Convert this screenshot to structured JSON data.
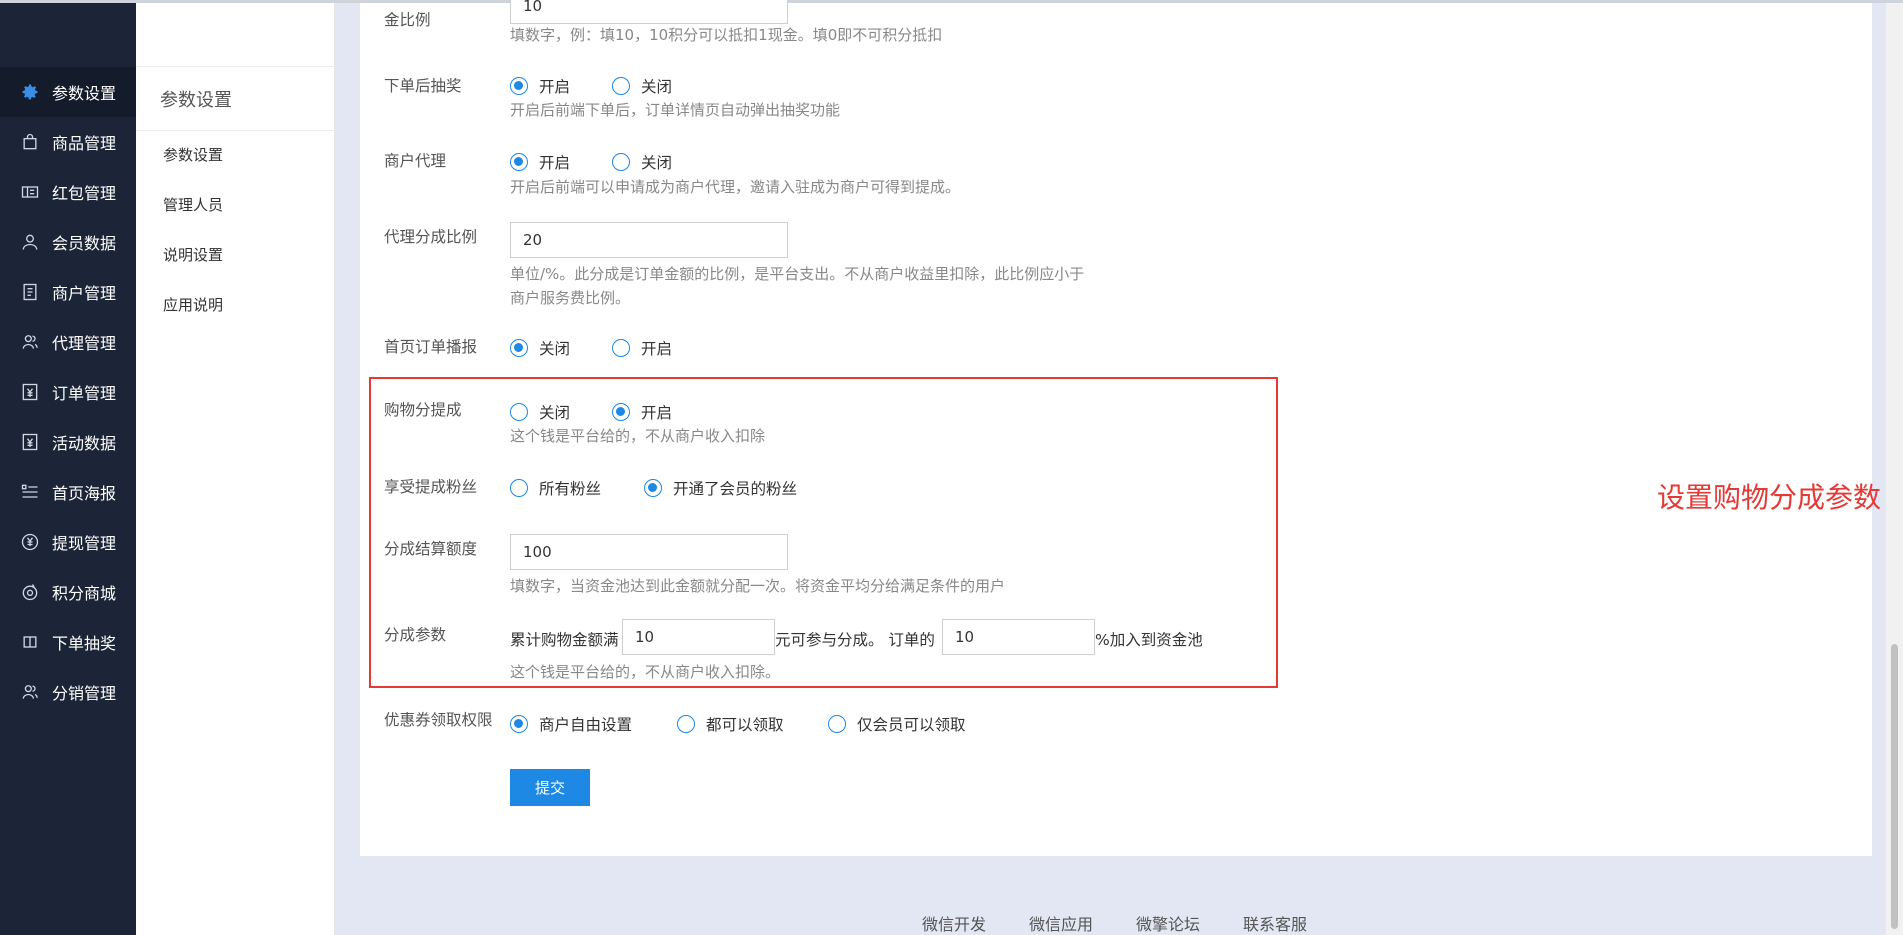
{
  "sidebar": {
    "items": [
      {
        "label": "参数设置",
        "icon": "gear-icon"
      },
      {
        "label": "商品管理",
        "icon": "bag-icon"
      },
      {
        "label": "红包管理",
        "icon": "ticket-icon"
      },
      {
        "label": "会员数据",
        "icon": "user-icon"
      },
      {
        "label": "商户管理",
        "icon": "document-icon"
      },
      {
        "label": "代理管理",
        "icon": "users-icon"
      },
      {
        "label": "订单管理",
        "icon": "yen-receipt-icon"
      },
      {
        "label": "活动数据",
        "icon": "yen-receipt-icon"
      },
      {
        "label": "首页海报",
        "icon": "list-icon"
      },
      {
        "label": "提现管理",
        "icon": "yen-circle-icon"
      },
      {
        "label": "积分商城",
        "icon": "coin-icon"
      },
      {
        "label": "下单抽奖",
        "icon": "book-icon"
      },
      {
        "label": "分销管理",
        "icon": "users-icon"
      }
    ]
  },
  "subnav": {
    "title": "参数设置",
    "items": [
      "参数设置",
      "管理人员",
      "说明设置",
      "应用说明"
    ]
  },
  "form": {
    "ratio_label": "金比例",
    "ratio_value": "10",
    "ratio_help": "填数字，例：填10，10积分可以抵扣1现金。填0即不可积分抵扣",
    "lottery_label": "下单后抽奖",
    "lottery_options": [
      "开启",
      "关闭"
    ],
    "lottery_help": "开启后前端下单后，订单详情页自动弹出抽奖功能",
    "agent_label": "商户代理",
    "agent_options": [
      "开启",
      "关闭"
    ],
    "agent_help": "开启后前端可以申请成为商户代理，邀请入驻成为商户可得到提成。",
    "agent_ratio_label": "代理分成比例",
    "agent_ratio_value": "20",
    "agent_ratio_help1": "单位/%。此分成是订单金额的比例，是平台支出。不从商户收益里扣除，此比例应小于",
    "agent_ratio_help2": "商户服务费比例。",
    "broadcast_label": "首页订单播报",
    "broadcast_options": [
      "关闭",
      "开启"
    ],
    "shop_commission_label": "购物分提成",
    "shop_commission_options": [
      "关闭",
      "开启"
    ],
    "shop_commission_help": "这个钱是平台给的，不从商户收入扣除",
    "fans_label": "享受提成粉丝",
    "fans_options": [
      "所有粉丝",
      "开通了会员的粉丝"
    ],
    "settle_label": "分成结算额度",
    "settle_value": "100",
    "settle_help": "填数字，当资金池达到此金额就分配一次。将资金平均分给满足条件的用户",
    "params_label": "分成参数",
    "params_prefix": "累计购物金额满",
    "params_value1": "10",
    "params_middle": "元可参与分成。 订单的",
    "params_value2": "10",
    "params_suffix": "%加入到资金池",
    "params_help": "这个钱是平台给的，不从商户收入扣除。",
    "coupon_label": "优惠券领取权限",
    "coupon_options": [
      "商户自由设置",
      "都可以领取",
      "仅会员可以领取"
    ],
    "submit_label": "提交"
  },
  "annotation": "设置购物分成参数",
  "footer": {
    "links": [
      "微信开发",
      "微信应用",
      "微擎论坛",
      "联系客服"
    ]
  },
  "colors": {
    "sidebar_bg": "#1c2538",
    "accent": "#1e88e5",
    "annotation": "#e53935",
    "page_bg": "#e3e7f3"
  }
}
